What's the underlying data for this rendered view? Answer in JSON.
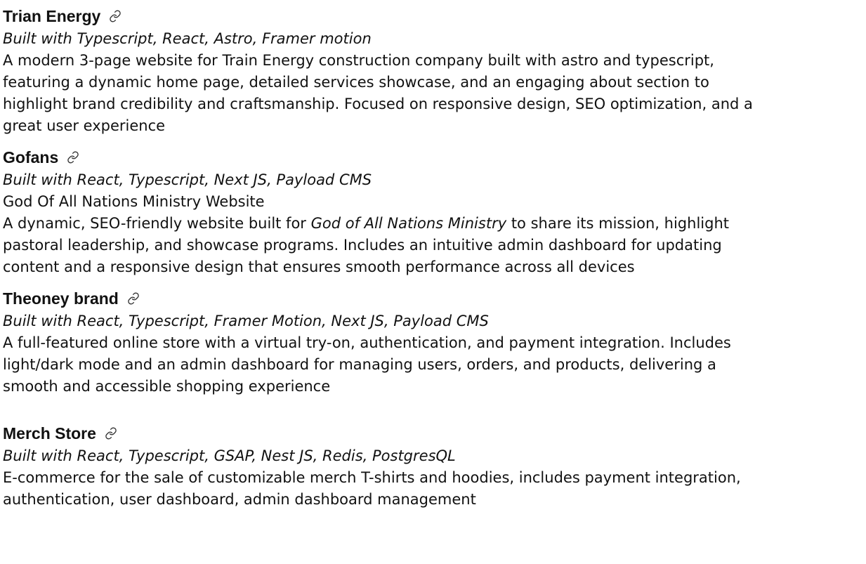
{
  "projects": [
    {
      "name": "Trian Energy",
      "icon": "link-icon",
      "built_with": "Built with Typescript, React, Astro, Framer motion",
      "description_lines": [
        "A modern 3-page website for Train Energy construction company built with astro and typescript,",
        "featuring a dynamic home page, detailed services showcase, and an engaging about section to",
        "highlight brand credibility and craftsmanship. Focused on responsive design, SEO optimization, and a",
        "great user experience"
      ]
    },
    {
      "name": "Gofans",
      "icon": "link-icon",
      "built_with": "Built with React, Typescript, Next JS, Payload CMS",
      "subtitle": "God Of All Nations Ministry Website",
      "description_first_prefix": "A dynamic, SEO-friendly website built for ",
      "description_first_italic": "God of All Nations Ministry",
      "description_first_suffix": " to share its mission, highlight",
      "description_lines": [
        "pastoral leadership, and showcase programs. Includes an intuitive admin dashboard for updating",
        "content and a responsive design that ensures smooth performance across all devices"
      ]
    },
    {
      "name": "Theoney brand",
      "icon": "link-icon",
      "built_with": "Built with React, Typescript, Framer Motion, Next JS, Payload CMS",
      "description_lines": [
        "A full-featured online store with a virtual try-on, authentication, and payment integration. Includes",
        "light/dark mode and an admin dashboard for managing users, orders, and products, delivering a",
        "smooth and accessible shopping experience"
      ]
    },
    {
      "name": "Merch Store",
      "icon": "link-icon",
      "built_with": "Built with React, Typescript, GSAP, Nest JS, Redis, PostgresQL",
      "description_lines": [
        "E-commerce for the sale of customizable merch T-shirts and hoodies, includes payment integration,",
        "authentication, user dashboard, admin dashboard management"
      ]
    }
  ]
}
